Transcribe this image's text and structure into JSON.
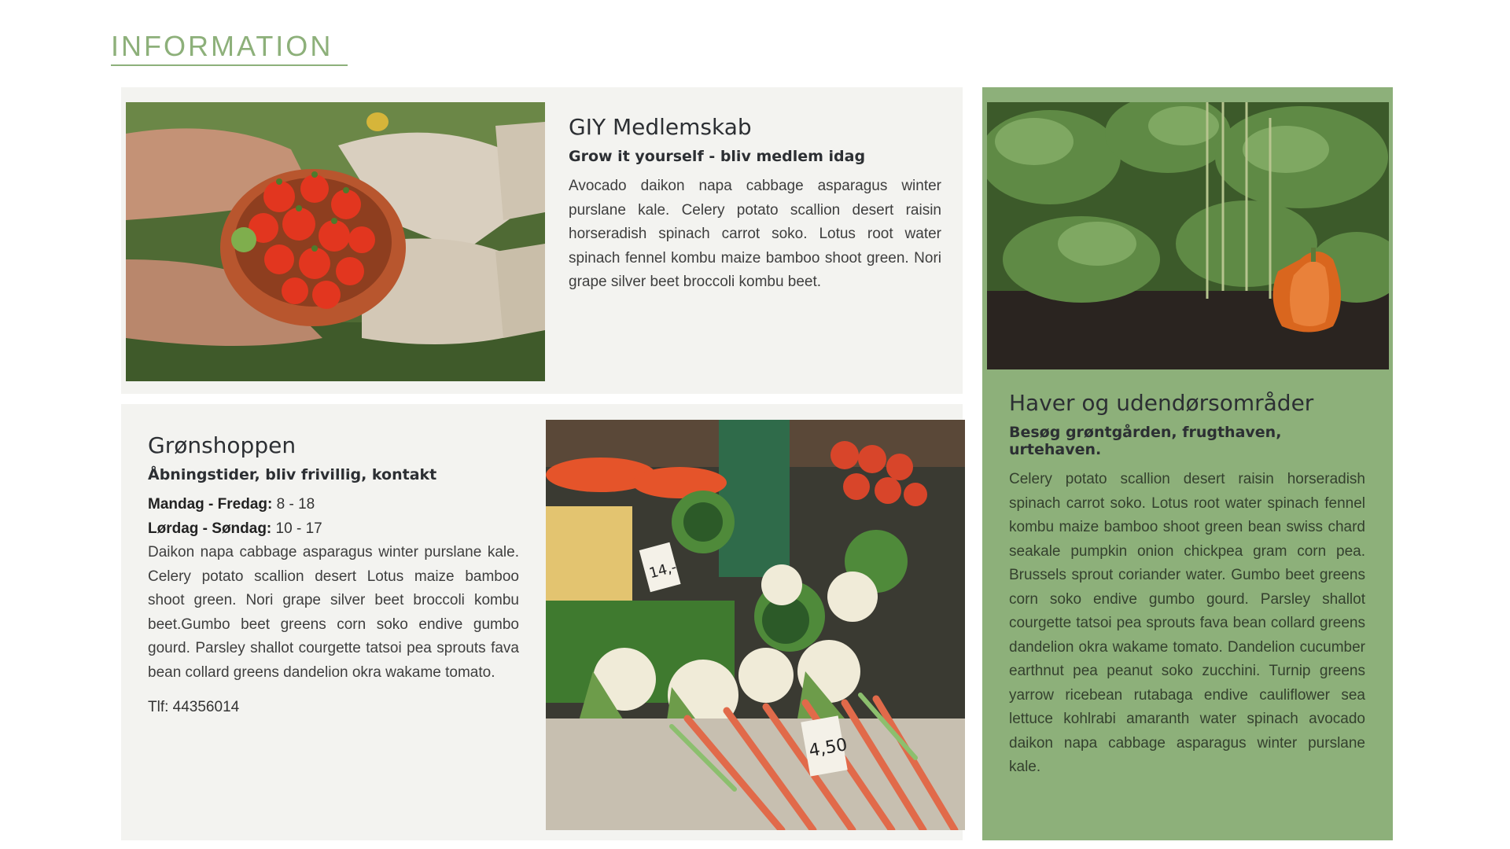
{
  "section": {
    "title": "INFORMATION"
  },
  "cards": {
    "membership": {
      "heading": "GIY Medlemskab",
      "subheading": "Grow it yourself - bliv medlem idag",
      "text": "Avocado daikon napa cabbage asparagus winter purslane kale. Celery potato scallion desert raisin horseradish spinach carrot soko. Lotus root water spinach fennel kombu maize bamboo shoot green. Nori grape silver beet broccoli kombu beet.",
      "image_alt": "Hands holding a bowl of tomatoes"
    },
    "shop": {
      "heading": "Grønshoppen",
      "subheading": "Åbningstider, bliv frivillig, kontakt",
      "weekday_label": "Mandag - Fredag:",
      "weekday_hours": "8 - 18",
      "weekend_label": "Lørdag - Søndag:",
      "weekend_hours": "10 - 17",
      "text": "Daikon napa cabbage asparagus winter purslane kale. Celery potato scallion desert Lotus maize bamboo shoot green. Nori grape silver beet broccoli kombu beet.Gumbo beet greens corn soko endive gumbo gourd. Parsley shallot courgette tatsoi pea sprouts fava bean collard greens dandelion okra wakame tomato.",
      "phone": "Tlf: 44356014",
      "image_alt": "Vegetable market stall",
      "price_tag_1": "14,-",
      "price_tag_2": "4,50"
    },
    "gardens": {
      "heading": "Haver og udendørsområder",
      "subheading": "Besøg grøntgården, frugthaven, urtehaven.",
      "text": "Celery potato scallion desert raisin horseradish spinach carrot soko. Lotus root water spinach fennel kombu maize bamboo shoot green bean swiss chard seakale pumpkin onion chickpea gram corn pea. Brussels sprout coriander water. Gumbo beet greens corn soko endive gumbo gourd. Parsley shallot courgette tatsoi pea sprouts fava bean collard greens dandelion okra wakame tomato. Dandelion cucumber earthnut pea peanut soko zucchini. Turnip greens yarrow ricebean rutabaga endive cauliflower sea lettuce kohlrabi amaranth water spinach avocado daikon napa cabbage asparagus winter purslane kale.",
      "image_alt": "Pumpkin growing among leaves"
    }
  },
  "colors": {
    "accent": "#8db07a",
    "card_bg": "#f3f3f0",
    "heading": "#2c2f33"
  }
}
